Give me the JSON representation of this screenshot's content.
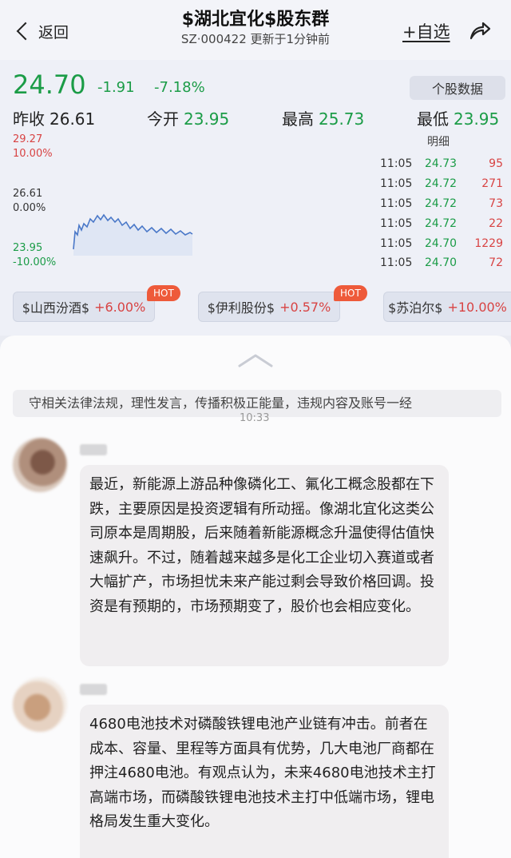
{
  "header": {
    "back_label": "返回",
    "title": "$湖北宜化$股东群",
    "subtitle": "SZ·000422  更新于1分钟前",
    "watch_label": "+自选"
  },
  "quote": {
    "price": "24.70",
    "change": "-1.91",
    "change_pct": "-7.18%",
    "stock_data_btn": "个股数据",
    "prev_close_label": "昨收",
    "prev_close": "26.61",
    "open_label": "今开",
    "open": "23.95",
    "high_label": "最高",
    "high": "25.73",
    "low_label": "最低",
    "low": "23.95"
  },
  "chart": {
    "y_top": "29.27",
    "pct_top": "10.00%",
    "y_mid": "26.61",
    "pct_mid": "0.00%",
    "y_bot": "23.95",
    "pct_bot": "-10.00%",
    "detail_label": "明细",
    "ticks": [
      {
        "time": "11:05",
        "price": "24.73",
        "qty": "95"
      },
      {
        "time": "11:05",
        "price": "24.72",
        "qty": "271"
      },
      {
        "time": "11:05",
        "price": "24.72",
        "qty": "73"
      },
      {
        "time": "11:05",
        "price": "24.72",
        "qty": "22"
      },
      {
        "time": "11:05",
        "price": "24.70",
        "qty": "1229"
      },
      {
        "time": "11:05",
        "price": "24.70",
        "qty": "72"
      }
    ]
  },
  "related": [
    {
      "name": "$山西汾酒$",
      "change": "+6.00%",
      "hot": "HOT"
    },
    {
      "name": "$伊利股份$",
      "change": "+0.57%",
      "hot": "HOT"
    },
    {
      "name": "$苏泊尔$",
      "change": "+10.00%"
    }
  ],
  "chat": {
    "notice": "守相关法律法规，理性发言，传播积极正能量，违规内容及账号一经",
    "time": "10:33",
    "messages": [
      {
        "text": "最近，新能源上游品种像磷化工、氟化工概念股都在下跌，主要原因是投资逻辑有所动摇。像湖北宜化这类公司原本是周期股，后来随着新能源概念升温使得估值快速飙升。不过，随着越来越多是化工企业切入赛道或者大幅扩产，市场担忧未来产能过剩会导致价格回调。投资是有预期的，市场预期变了，股价也会相应变化。"
      },
      {
        "text": "4680电池技术对磷酸铁锂电池产业链有冲击。前者在成本、容量、里程等方面具有优势，几大电池厂商都在押注4680电池。有观点认为，未来4680电池技术主打高端市场，而磷酸铁锂电池技术主打中低端市场，锂电格局发生重大变化。"
      }
    ]
  },
  "colors": {
    "down": "#1b9c47",
    "up": "#d84343",
    "hot": "#ee5a3a"
  }
}
